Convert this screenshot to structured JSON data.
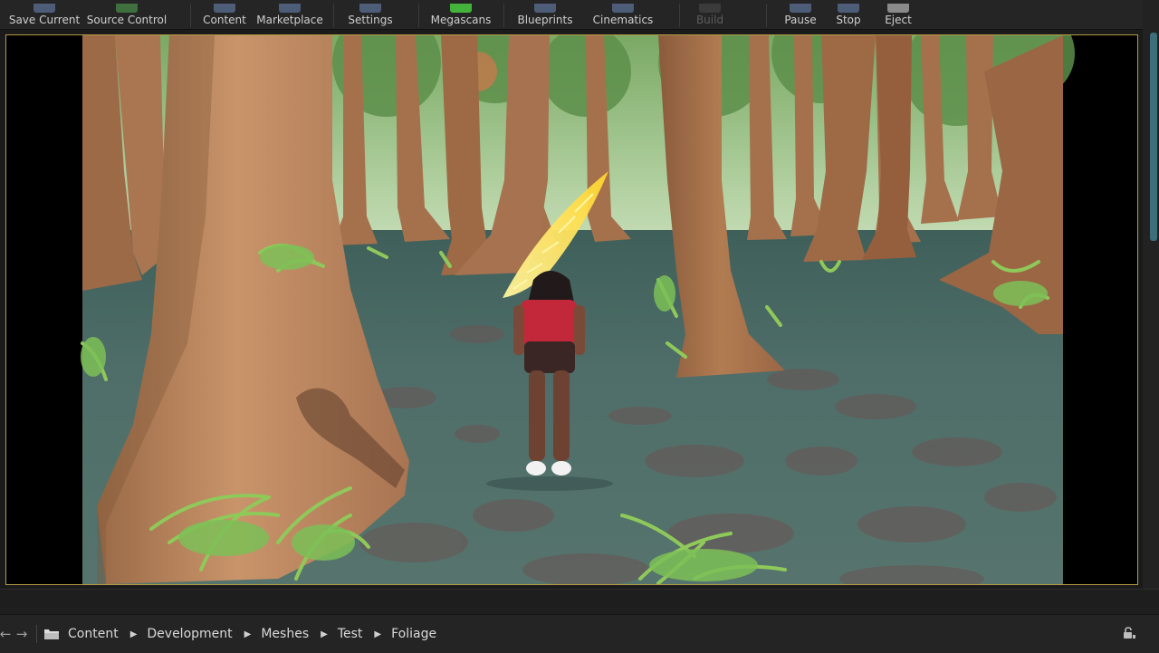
{
  "toolbar": {
    "buttons": [
      {
        "label": "Save Current",
        "icon": "save-icon"
      },
      {
        "label": "Source Control",
        "icon": "source-control-icon"
      },
      {
        "label": "Content",
        "icon": "content-icon"
      },
      {
        "label": "Marketplace",
        "icon": "marketplace-icon"
      },
      {
        "label": "Settings",
        "icon": "settings-icon"
      },
      {
        "label": "Megascans",
        "icon": "megascans-icon"
      },
      {
        "label": "Blueprints",
        "icon": "blueprints-icon"
      },
      {
        "label": "Cinematics",
        "icon": "cinematics-icon"
      },
      {
        "label": "Build",
        "icon": "build-icon",
        "disabled": true
      },
      {
        "label": "Pause",
        "icon": "pause-icon"
      },
      {
        "label": "Stop",
        "icon": "stop-icon"
      },
      {
        "label": "Eject",
        "icon": "eject-icon"
      }
    ]
  },
  "viewport": {
    "scene": "forest-with-character-playing",
    "colors": {
      "border": "#b49a45",
      "ground": "#4f6e69",
      "trunk": "#a06c46",
      "fern": "#8fc95a",
      "highlight": "#ffe45a"
    }
  },
  "breadcrumb": {
    "back_icon": "back-arrow-icon",
    "forward_icon": "forward-arrow-icon",
    "items": [
      "Content",
      "Development",
      "Meshes",
      "Test",
      "Foliage"
    ],
    "lock_icon": "lock-icon"
  }
}
